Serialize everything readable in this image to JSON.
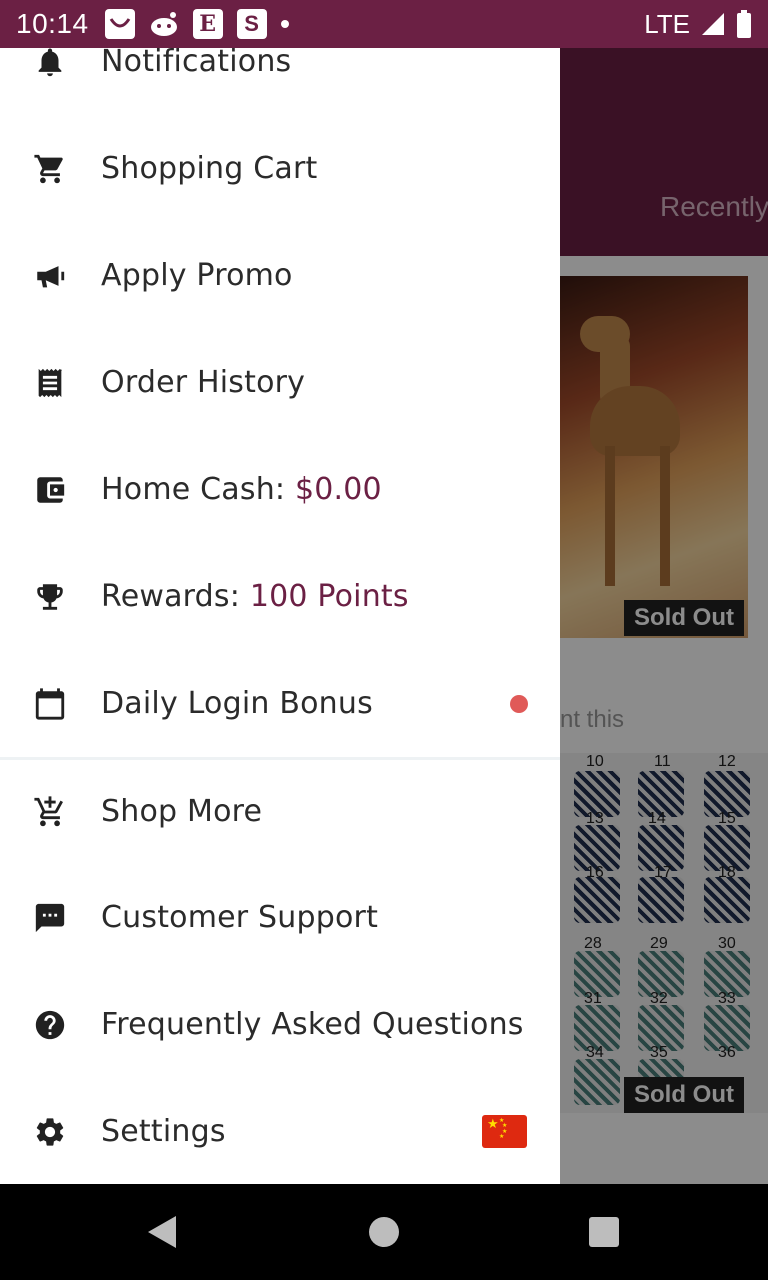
{
  "status_bar": {
    "time": "10:14",
    "notification_icons": [
      "shopping-bag-icon",
      "reddit-icon",
      "etsy-icon",
      "s-app-icon",
      "dot-icon"
    ],
    "etsy_letter": "E",
    "s_letter": "S",
    "network": "LTE"
  },
  "background": {
    "tab_label": "Recently",
    "sold_out_label": "Sold Out",
    "subtext": "nt this",
    "pillow_numbers": [
      "10",
      "11",
      "12",
      "13",
      "14",
      "15",
      "16",
      "17",
      "18",
      "28",
      "29",
      "30",
      "31",
      "32",
      "33",
      "34",
      "35",
      "36"
    ]
  },
  "drawer": {
    "items": [
      {
        "label": "Notifications",
        "icon": "bell-icon"
      },
      {
        "label": "Shopping Cart",
        "icon": "cart-icon"
      },
      {
        "label": "Apply Promo",
        "icon": "megaphone-icon"
      },
      {
        "label": "Order History",
        "icon": "receipt-icon"
      },
      {
        "label": "Home Cash: ",
        "value": "$0.00",
        "icon": "wallet-icon"
      },
      {
        "label": "Rewards: ",
        "value": "100 Points",
        "icon": "trophy-icon"
      },
      {
        "label": "Daily Login Bonus",
        "icon": "calendar-icon",
        "badge": "red-dot"
      },
      {
        "label": "Shop More",
        "icon": "add-to-cart-icon"
      },
      {
        "label": "Customer Support",
        "icon": "chat-icon"
      },
      {
        "label": "Frequently Asked Questions",
        "icon": "help-icon"
      },
      {
        "label": "Settings",
        "icon": "gear-icon",
        "flag": "china-flag-icon"
      }
    ]
  },
  "colors": {
    "brand": "#6b2044",
    "badge": "#e05a58",
    "text": "#2b2b2b"
  },
  "nav_bar": {
    "icons": [
      "back-icon",
      "home-icon",
      "recent-apps-icon"
    ]
  }
}
